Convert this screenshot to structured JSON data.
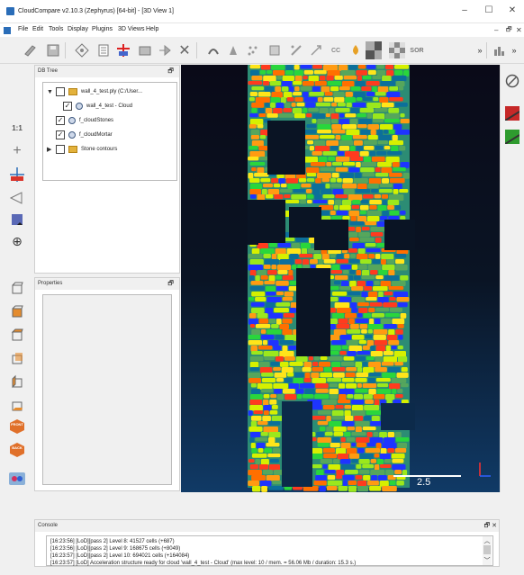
{
  "window": {
    "title": "CloudCompare v2.10.3 (Zephyrus) [64-bit] - [3D View 1]",
    "controls": {
      "minimize": "–",
      "maximize": "☐",
      "close": "✕"
    },
    "mdi_controls": {
      "minimize": "–",
      "restore": "🗗",
      "close": "✕"
    }
  },
  "menubar": {
    "items": [
      "File",
      "Edit",
      "Tools",
      "Display",
      "Plugins",
      "3D Views",
      "Help"
    ]
  },
  "toolbar": {
    "icons": [
      "open-icon",
      "save-icon",
      "global-shift-icon",
      "properties-list-icon",
      "segment-icon",
      "translate-rotate-icon",
      "merge-icon",
      "delete-icon",
      "pick-point-icon",
      "sample-icon",
      "subsample-icon",
      "compute-normals-icon",
      "registration-icon",
      "fine-registration-icon",
      "cloud-cloud-distance-icon",
      "color-icon",
      "texture-icon",
      "sor-icon",
      "more-icon",
      "histogram-icon",
      "more2-icon"
    ],
    "cc_label": "CC",
    "sor_label": "SOR",
    "overflow": "»"
  },
  "left_toolbar": {
    "ratio_label": "1:1"
  },
  "db_tree": {
    "header": "DB Tree",
    "items": [
      {
        "label": "wall_4_test.ply (C:/User...",
        "level": 0,
        "expanded": true,
        "checked": false,
        "icon": "folder-icon"
      },
      {
        "label": "wall_4_test - Cloud",
        "level": 1,
        "checked": true,
        "icon": "cloud-icon"
      },
      {
        "label": "f_cloudStones",
        "level": 0,
        "checked": true,
        "icon": "cloud-icon"
      },
      {
        "label": "f_cloudMortar",
        "level": 0,
        "checked": true,
        "icon": "cloud-icon"
      },
      {
        "label": "Stone contours",
        "level": 0,
        "expanded": false,
        "checked": false,
        "icon": "folder-icon"
      }
    ]
  },
  "properties": {
    "header": "Properties"
  },
  "view3d": {
    "scale_label": "2.5"
  },
  "console": {
    "header": "Console",
    "lines": [
      "[16:23:56] [LoD][pass 2] Level 8: 41527 cells (+687)",
      "[16:23:56] [LoD][pass 2] Level 9: 168675 cells (+8049)",
      "[16:23:57] [LoD][pass 2] Level 10: 694021 cells (+164084)",
      "[16:23:57] [LoD] Acceleration structure ready for cloud 'wall_4_test - Cloud' (max level: 10 / mem. = 56.06 Mb / duration: 15.3 s.)"
    ]
  },
  "colors": {
    "stones": [
      "#ff3b1e",
      "#ff9b12",
      "#ffe51a",
      "#9be81c",
      "#29d63c",
      "#1e34ff",
      "#0c6f9a",
      "#56a65c",
      "#d6f000",
      "#ff6f00"
    ],
    "mortar": "#2c8c74",
    "view_bg_top": "#0a0a18",
    "view_bg_bottom": "#103a66"
  }
}
